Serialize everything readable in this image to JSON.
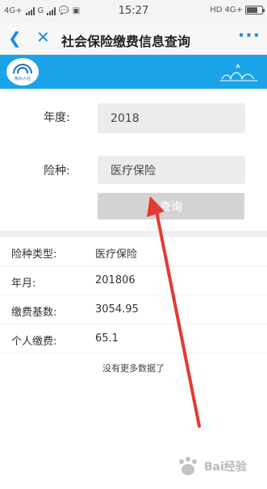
{
  "status_bar": {
    "left_net1": "4G+",
    "left_net2": "G",
    "time": "15:27",
    "right_hd": "HD",
    "right_net": "4G+",
    "battery_level": 0.7
  },
  "header": {
    "title": "社会保险缴费信息查询",
    "more_label": "···"
  },
  "banner": {
    "logo_text": "荆州人社"
  },
  "form": {
    "year_label": "年度:",
    "year_value": "2018",
    "type_label": "险种:",
    "type_value": "医疗保险",
    "query_button": "查询"
  },
  "results": [
    {
      "key": "险种类型:",
      "value": "医疗保险"
    },
    {
      "key": "年月:",
      "value": "201806"
    },
    {
      "key": "缴费基数:",
      "value": "3054.95"
    },
    {
      "key": "个人缴费:",
      "value": "65.1"
    }
  ],
  "no_more_text": "没有更多数据了",
  "watermark": "Bai经验",
  "colors": {
    "accent": "#1e88e5",
    "banner": "#1aa3e8",
    "annotation_arrow": "#e53935"
  }
}
